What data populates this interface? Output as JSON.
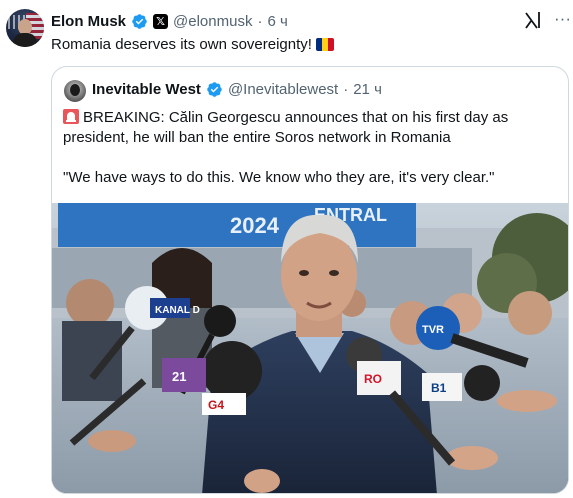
{
  "post": {
    "author_name": "Elon Musk",
    "author_handle": "@elonmusk",
    "separator": "·",
    "time": "6 ч",
    "text": "Romania deserves its own sovereignty!",
    "more_label": "···",
    "grok_icon": "grok-icon",
    "verified_color": "#1d9bf0"
  },
  "flag": {
    "colors": [
      "#002b7f",
      "#fcd116",
      "#ce1126"
    ]
  },
  "quote": {
    "author_name": "Inevitable West",
    "author_handle": "@Inevitablewest",
    "separator": "·",
    "time": "21 ч",
    "text": "BREAKING: Călin Georgescu announces that on his first day as president, he will ban the entire Soros network in Romania",
    "quote_line": "\"We have ways to do this. We know who they are, it's very clear.\""
  },
  "photo": {
    "banner_text": "2024",
    "banner_text_right": "ENTRAL",
    "mic_labels": [
      "KANAL D",
      "TVR",
      "B1",
      "RO",
      "21",
      "G4"
    ]
  }
}
